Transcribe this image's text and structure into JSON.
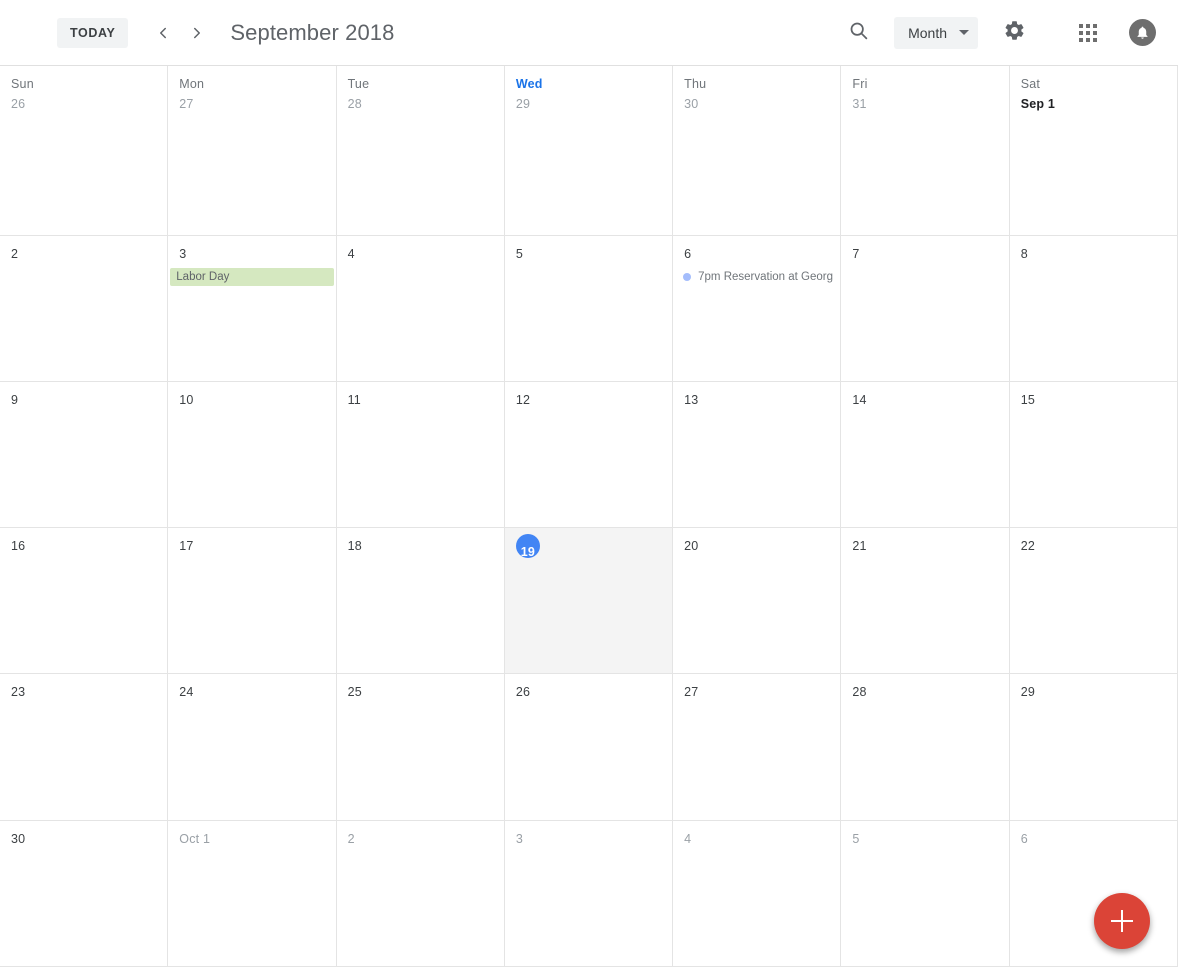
{
  "toolbar": {
    "today_label": "TODAY",
    "prev_icon": "chevron-left-icon",
    "next_icon": "chevron-right-icon",
    "title": "September 2018",
    "search_icon": "search-icon",
    "view_label": "Month",
    "settings_icon": "gear-icon",
    "apps_icon": "apps-grid-icon",
    "notifications_icon": "bell-icon"
  },
  "calendar": {
    "weekday_headers": [
      {
        "label": "Sun",
        "is_today": false
      },
      {
        "label": "Mon",
        "is_today": false
      },
      {
        "label": "Tue",
        "is_today": false
      },
      {
        "label": "Wed",
        "is_today": true
      },
      {
        "label": "Thu",
        "is_today": false
      },
      {
        "label": "Fri",
        "is_today": false
      },
      {
        "label": "Sat",
        "is_today": false
      }
    ],
    "weeks": [
      [
        {
          "day": "26",
          "style": "muted-prev"
        },
        {
          "day": "27",
          "style": "muted-prev"
        },
        {
          "day": "28",
          "style": "muted-prev"
        },
        {
          "day": "29",
          "style": "muted-prev"
        },
        {
          "day": "30",
          "style": "muted-prev"
        },
        {
          "day": "31",
          "style": "muted-prev"
        },
        {
          "day": "Sep 1",
          "style": "emph"
        }
      ],
      [
        {
          "day": "2",
          "style": "normal"
        },
        {
          "day": "3",
          "style": "normal",
          "chip": {
            "label": "Labor Day",
            "color": "green"
          }
        },
        {
          "day": "4",
          "style": "normal"
        },
        {
          "day": "5",
          "style": "normal"
        },
        {
          "day": "6",
          "style": "normal",
          "event": {
            "label": "7pm Reservation at Georg",
            "dot_color": "#a4bdfc"
          }
        },
        {
          "day": "7",
          "style": "normal"
        },
        {
          "day": "8",
          "style": "normal"
        }
      ],
      [
        {
          "day": "9",
          "style": "normal"
        },
        {
          "day": "10",
          "style": "normal"
        },
        {
          "day": "11",
          "style": "normal"
        },
        {
          "day": "12",
          "style": "normal"
        },
        {
          "day": "13",
          "style": "normal"
        },
        {
          "day": "14",
          "style": "normal"
        },
        {
          "day": "15",
          "style": "normal"
        }
      ],
      [
        {
          "day": "16",
          "style": "normal"
        },
        {
          "day": "17",
          "style": "normal"
        },
        {
          "day": "18",
          "style": "normal"
        },
        {
          "day": "19",
          "style": "today"
        },
        {
          "day": "20",
          "style": "normal"
        },
        {
          "day": "21",
          "style": "normal"
        },
        {
          "day": "22",
          "style": "normal"
        }
      ],
      [
        {
          "day": "23",
          "style": "normal"
        },
        {
          "day": "24",
          "style": "normal"
        },
        {
          "day": "25",
          "style": "normal"
        },
        {
          "day": "26",
          "style": "normal"
        },
        {
          "day": "27",
          "style": "normal"
        },
        {
          "day": "28",
          "style": "normal"
        },
        {
          "day": "29",
          "style": "normal"
        }
      ],
      [
        {
          "day": "30",
          "style": "normal"
        },
        {
          "day": "Oct 1",
          "style": "muted-next"
        },
        {
          "day": "2",
          "style": "muted-next"
        },
        {
          "day": "3",
          "style": "muted-next"
        },
        {
          "day": "4",
          "style": "muted-next"
        },
        {
          "day": "5",
          "style": "muted-next"
        },
        {
          "day": "6",
          "style": "muted-next"
        }
      ]
    ]
  },
  "fab": {
    "icon": "plus-icon",
    "label": "Create event"
  },
  "colors": {
    "today_blue": "#4285f4",
    "today_weekday_blue": "#1a73e8",
    "event_dot": "#a4bdfc",
    "holiday_chip": "#d5e8c0",
    "fab_red": "#db4437",
    "grid_line": "#e4e4e4",
    "today_cell_bg": "#f4f4f4"
  }
}
